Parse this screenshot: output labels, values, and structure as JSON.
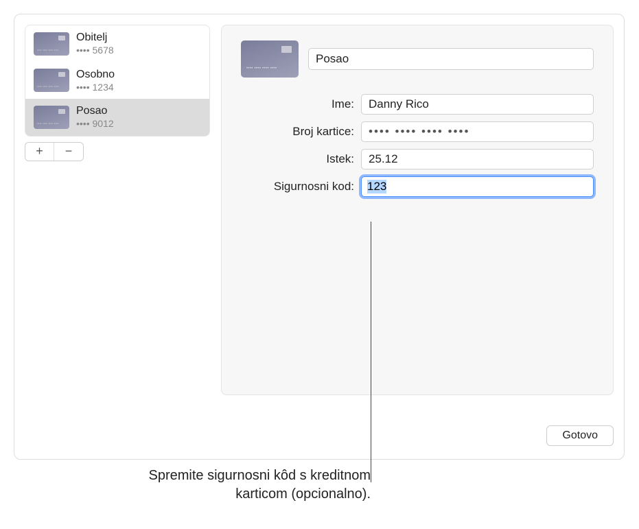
{
  "sidebar": {
    "items": [
      {
        "name": "Obitelj",
        "digits": "•••• 5678",
        "selected": false
      },
      {
        "name": "Osobno",
        "digits": "•••• 1234",
        "selected": false
      },
      {
        "name": "Posao",
        "digits": "•••• 9012",
        "selected": true
      }
    ]
  },
  "detail": {
    "title": "Posao",
    "labels": {
      "name": "Ime:",
      "number": "Broj kartice:",
      "expiry": "Istek:",
      "security": "Sigurnosni kod:"
    },
    "values": {
      "name": "Danny Rico",
      "number_masked": "•••• •••• •••• ••••",
      "expiry": "25.12",
      "security": "123"
    }
  },
  "buttons": {
    "add": "+",
    "remove": "−",
    "done": "Gotovo"
  },
  "callout": {
    "line1": "Spremite sigurnosni kôd s kreditnom",
    "line2": "karticom (opcionalno)."
  }
}
